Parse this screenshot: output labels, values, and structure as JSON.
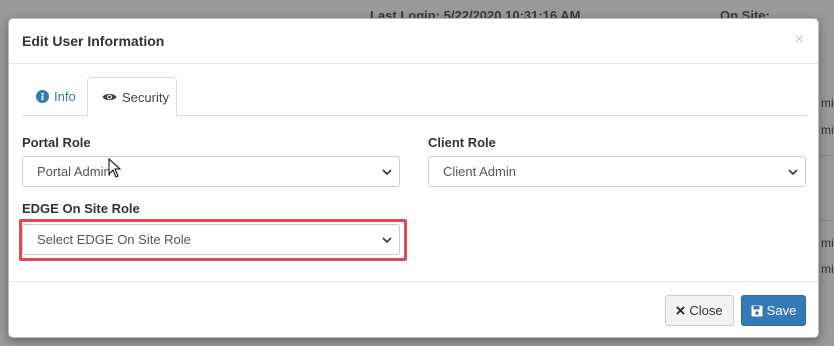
{
  "background": {
    "top_left_text": "Last Login: 5/22/2020 10:31:16 AM",
    "top_right_text": "On Site:",
    "right_edge_texts": [
      "mi",
      "mi",
      "mi",
      "mi"
    ]
  },
  "modal": {
    "title": "Edit User Information",
    "close_symbol": "×",
    "tabs": [
      {
        "label": "Info",
        "icon": "info-circle-icon",
        "active": false
      },
      {
        "label": "Security",
        "icon": "eye-icon",
        "active": true
      }
    ],
    "fields": {
      "portal_role": {
        "label": "Portal Role",
        "value": "Portal Admin"
      },
      "client_role": {
        "label": "Client Role",
        "value": "Client Admin"
      },
      "edge_role": {
        "label": "EDGE On Site Role",
        "value": "Select EDGE On Site Role"
      }
    },
    "footer": {
      "close_label": "Close",
      "save_label": "Save"
    }
  },
  "colors": {
    "primary": "#337ab7",
    "highlight": "#e24b4b"
  }
}
